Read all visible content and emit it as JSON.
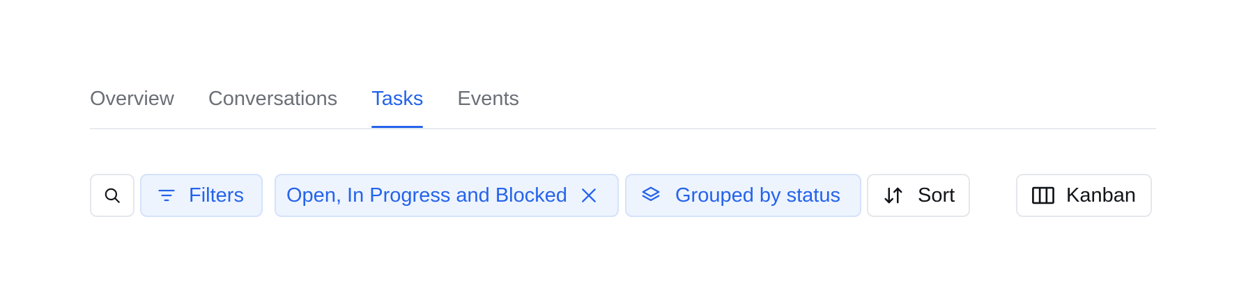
{
  "tabs": [
    {
      "label": "Overview",
      "active": false
    },
    {
      "label": "Conversations",
      "active": false
    },
    {
      "label": "Tasks",
      "active": true
    },
    {
      "label": "Events",
      "active": false
    }
  ],
  "toolbar": {
    "search_icon": "search-icon",
    "filters_label": "Filters",
    "filters_icon": "filter-lines-icon",
    "status_chip_label": "Open, In Progress and Blocked",
    "status_chip_clear_icon": "close-icon",
    "group_label": "Grouped by status",
    "group_icon": "layers-icon",
    "sort_label": "Sort",
    "sort_icon": "sort-arrows-icon",
    "view_label": "Kanban",
    "view_icon": "kanban-columns-icon"
  },
  "colors": {
    "accent": "#2563eb",
    "tab_inactive": "#6b6f76",
    "chip_background": "#eef4fe",
    "border": "#e4e7eb",
    "text": "#111418"
  }
}
